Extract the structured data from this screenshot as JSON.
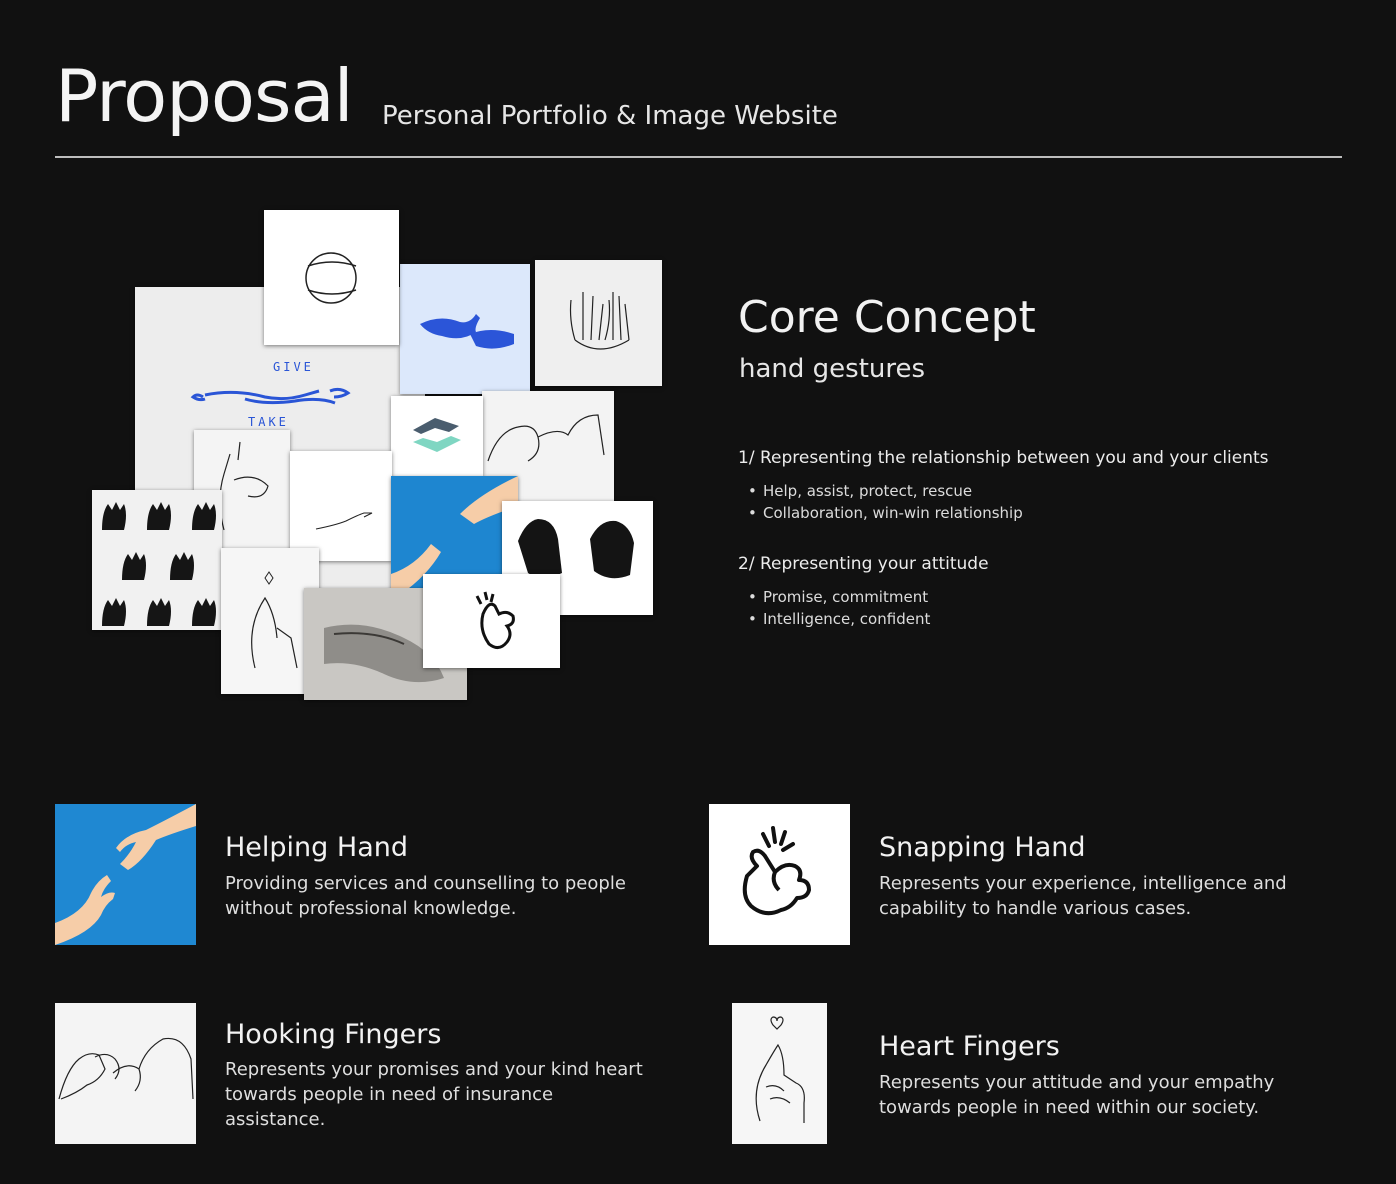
{
  "header": {
    "title": "Proposal",
    "subtitle": "Personal Portfolio & Image Website"
  },
  "moodboard": {
    "give_label": "GIVE",
    "take_label": "TAKE"
  },
  "concept": {
    "title": "Core Concept",
    "subtitle": "hand gestures",
    "points": [
      {
        "heading": "1/ Representing the relationship between you and your clients",
        "bullets": [
          "Help, assist, protect, rescue",
          "Collaboration, win-win relationship"
        ]
      },
      {
        "heading": "2/ Representing your attitude",
        "bullets": [
          "Promise, commitment",
          "Intelligence, confident"
        ]
      }
    ]
  },
  "features": [
    {
      "title": "Helping Hand",
      "description": "Providing services and counselling to people without professional knowledge.",
      "icon": "helping-hand-image"
    },
    {
      "title": "Snapping Hand",
      "description": "Represents your experience, intelligence and capability to handle various cases.",
      "icon": "snapping-hand-icon"
    },
    {
      "title": "Hooking Fingers",
      "description": "Represents your promises and your kind heart towards people in need of insurance assistance.",
      "icon": "hooking-fingers-sketch"
    },
    {
      "title": "Heart Fingers",
      "description": "Represents your attitude and your empathy towards people in need within our society.",
      "icon": "heart-fingers-sketch"
    }
  ],
  "colors": {
    "background": "#111111",
    "text": "#ffffff",
    "accent_blue": "#2186cf",
    "skin": "#f3c6a2",
    "rule": "#bdbdbd"
  }
}
